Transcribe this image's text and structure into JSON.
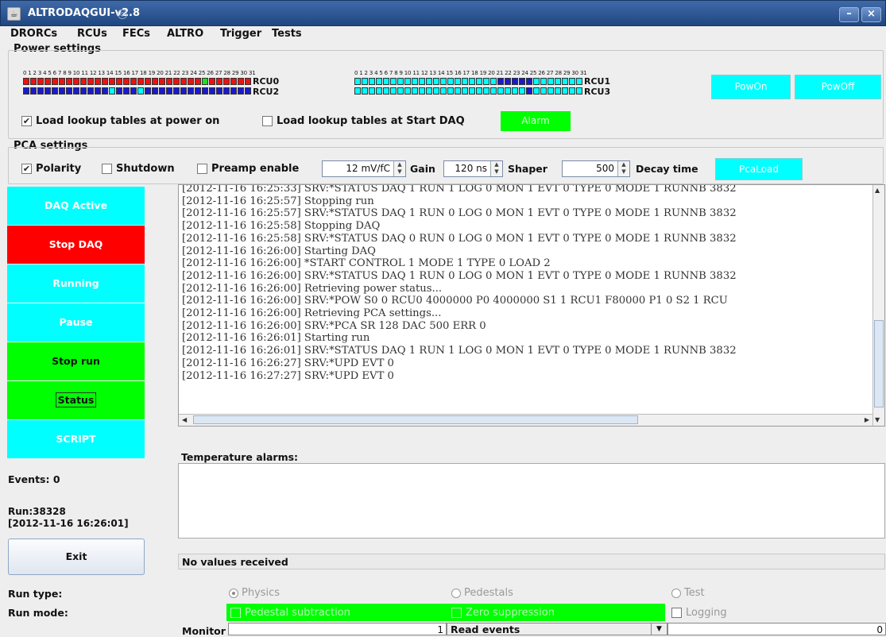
{
  "window": {
    "title": "ALTRODAQGUI-v2.8",
    "minimize": "–",
    "close": "×"
  },
  "menu": [
    "DRORCs",
    "RCUs",
    "FECs",
    "ALTRO",
    "Trigger",
    "Tests"
  ],
  "power": {
    "section_label": "Power settings",
    "channel_numbers": "0 1 2 3 4 5 6 7 8 9 10 11 12 13 14 15 16 17 18 19 20 21 22 23 24 25 26 27 28 29 30 31",
    "rcu_labels": [
      "RCU0",
      "RCU1",
      "RCU2",
      "RCU3"
    ],
    "rcu_channels": {
      "rcu0": "RRRRRRRRRRRRRRRRRRRRRRRRRGRRRRRR",
      "rcu1": "CCCCCCCCCCCCCCCCCCCCBBBBBCCCCCCC",
      "rcu2": "BBBBBBBBBBBBCBBBCBBBBBBBBBBBBBBB",
      "rcu3": "CCCCCCCCCCCCCCCCCCCCCCCCBCCCCCCC"
    },
    "channel_colors": {
      "R": "#ee1111",
      "G": "#22dd22",
      "C": "#00ffff",
      "B": "#1a1acc"
    },
    "pow_on": "PowOn",
    "pow_off": "PowOff",
    "load_lookup_power_on": {
      "label": "Load lookup tables at power on",
      "checked": true
    },
    "load_lookup_start_daq": {
      "label": "Load lookup tables at Start DAQ",
      "checked": false
    },
    "alarm": "Alarm"
  },
  "pca": {
    "section_label": "PCA settings",
    "polarity": {
      "label": "Polarity",
      "checked": true
    },
    "shutdown": {
      "label": "Shutdown",
      "checked": false
    },
    "preamp_enable": {
      "label": "Preamp enable",
      "checked": false
    },
    "gain_value": "12 mV/fC",
    "gain_label": "Gain",
    "shaper_value": "120 ns",
    "shaper_label": "Shaper",
    "decay_value": "500",
    "decay_label": "Decay time",
    "pca_load": "PcaLoad"
  },
  "side_buttons": [
    {
      "label": "DAQ Active",
      "bg": "#00ffff",
      "fg": "#ffffff"
    },
    {
      "label": "Stop DAQ",
      "bg": "#ff0000",
      "fg": "#ffffff"
    },
    {
      "label": "Running",
      "bg": "#00ffff",
      "fg": "#ffffff"
    },
    {
      "label": "Pause",
      "bg": "#00ffff",
      "fg": "#ffffff"
    },
    {
      "label": "Stop run",
      "bg": "#00ff00",
      "fg": "#111111"
    },
    {
      "label": "Status",
      "bg": "#00ff00",
      "fg": "#111111"
    },
    {
      "label": "SCRIPT",
      "bg": "#00ffff",
      "fg": "#ffffff"
    }
  ],
  "log_lines": [
    "[2012-11-16 16:25:33] SRV:*STATUS DAQ 1 RUN 1 LOG 0 MON 1 EVT 0 TYPE 0 MODE 1 RUNNB 3832",
    "[2012-11-16 16:25:57] Stopping run",
    "[2012-11-16 16:25:57] SRV:*STATUS DAQ 1 RUN 0 LOG 0 MON 1 EVT 0 TYPE 0 MODE 1 RUNNB 3832",
    "[2012-11-16 16:25:58] Stopping DAQ",
    "[2012-11-16 16:25:58] SRV:*STATUS DAQ 0 RUN 0 LOG 0 MON 1 EVT 0 TYPE 0 MODE 1 RUNNB 3832",
    "[2012-11-16 16:26:00] Starting DAQ",
    "[2012-11-16 16:26:00] *START CONTROL 1 MODE 1 TYPE 0 LOAD 2",
    "[2012-11-16 16:26:00] SRV:*STATUS DAQ 1 RUN 0 LOG 0 MON 1 EVT 0 TYPE 0 MODE 1 RUNNB 3832",
    "[2012-11-16 16:26:00] Retrieving power status...",
    "[2012-11-16 16:26:00] SRV:*POW S0 0 RCU0 4000000 P0 4000000 S1 1 RCU1 F80000 P1 0 S2 1 RCU",
    "[2012-11-16 16:26:00] Retrieving PCA settings...",
    "[2012-11-16 16:26:00] SRV:*PCA SR 128 DAC 500 ERR 0",
    "[2012-11-16 16:26:01] Starting run",
    "[2012-11-16 16:26:01] SRV:*STATUS DAQ 1 RUN 1 LOG 0 MON 1 EVT 0 TYPE 0 MODE 1 RUNNB 3832",
    "[2012-11-16 16:26:27] SRV:*UPD EVT 0",
    "[2012-11-16 16:27:27] SRV:*UPD EVT 0"
  ],
  "events": "Events: 0",
  "run_number": "Run:38328",
  "run_time": "[2012-11-16 16:26:01]",
  "exit": "Exit",
  "temperature_label": "Temperature alarms:",
  "no_values": "No values received",
  "run_type": {
    "label": "Run type:",
    "options": [
      "Physics",
      "Pedestals",
      "Test"
    ],
    "selected": "Physics"
  },
  "run_mode": {
    "label": "Run mode:",
    "pedestal_subtraction": "Pedestal subtraction",
    "zero_suppression": "Zero suppression",
    "logging": "Logging"
  },
  "monitor": {
    "label": "Monitor",
    "value": "1",
    "select": "Read events",
    "right_value": "0"
  }
}
